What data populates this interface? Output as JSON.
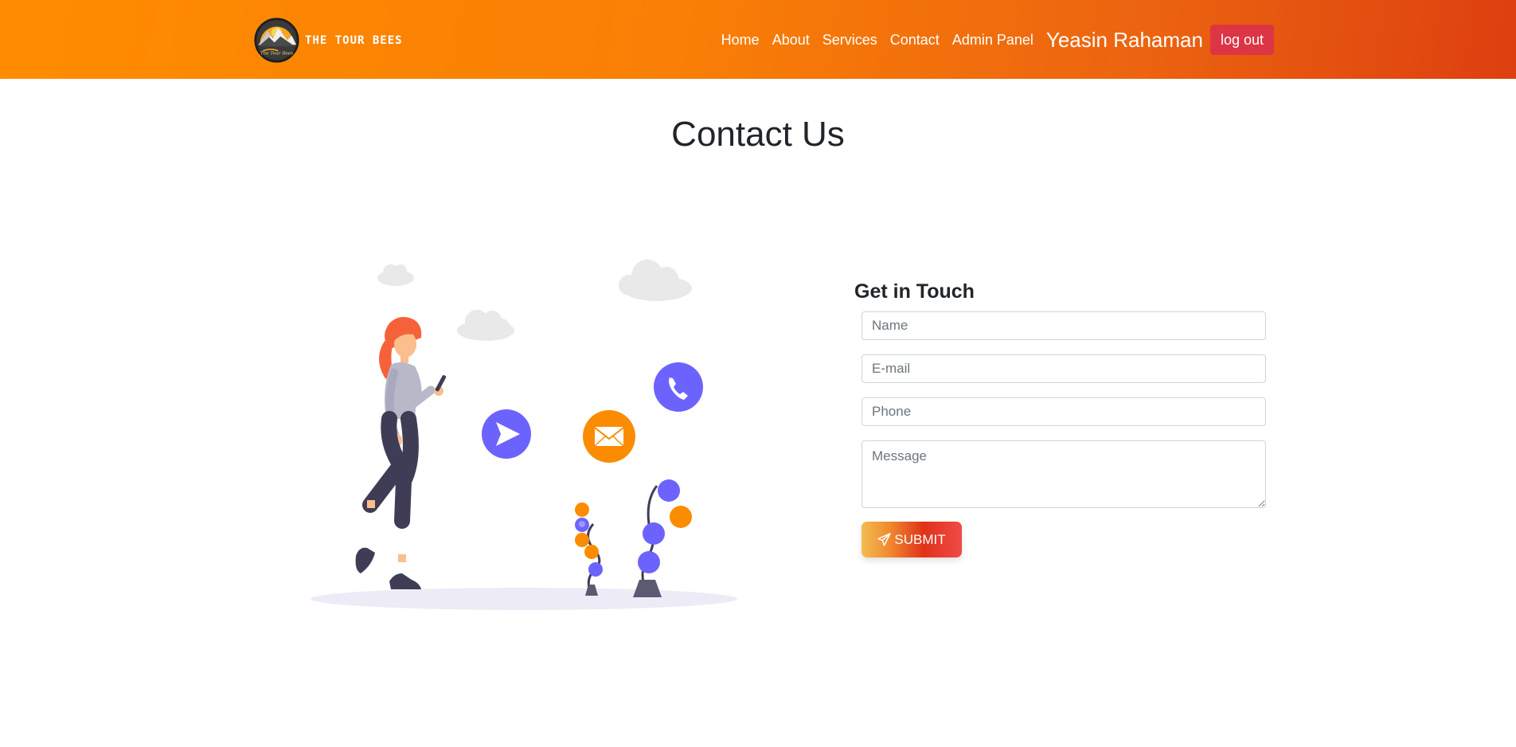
{
  "brand": {
    "name": "THE TOUR BEES",
    "logo_icon": "mountain-logo-icon",
    "logo_script": "The Tour Bees"
  },
  "nav": {
    "items": [
      {
        "label": "Home"
      },
      {
        "label": "About"
      },
      {
        "label": "Services"
      },
      {
        "label": "Contact"
      },
      {
        "label": "Admin Panel"
      }
    ],
    "user_name": "Yeasin Rahaman",
    "logout_label": "log out"
  },
  "page": {
    "title": "Contact Us"
  },
  "form": {
    "title": "Get in Touch",
    "fields": {
      "name": {
        "placeholder": "Name",
        "value": ""
      },
      "email": {
        "placeholder": "E-mail",
        "value": ""
      },
      "phone": {
        "placeholder": "Phone",
        "value": ""
      },
      "message": {
        "placeholder": "Message",
        "value": ""
      }
    },
    "submit_label": "SUBMIT",
    "submit_icon": "paper-plane-icon"
  },
  "illustration": {
    "icons": [
      "send-icon",
      "envelope-icon",
      "phone-icon"
    ]
  },
  "colors": {
    "nav_start": "#ff8c00",
    "nav_end": "#dd3f10",
    "logout_bg": "#dc3545",
    "accent_purple": "#6c63ff",
    "accent_orange": "#fb8c00"
  }
}
